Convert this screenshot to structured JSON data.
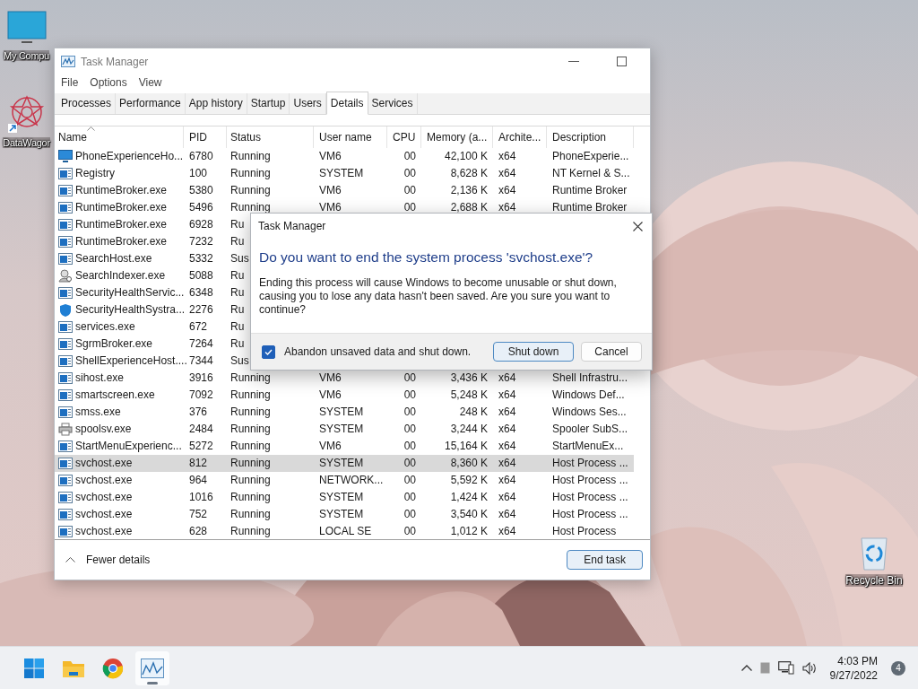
{
  "desktop_icons": [
    {
      "kind": "monitor",
      "label": "My Compu"
    },
    {
      "kind": "shortcut",
      "label": "DataWagor"
    },
    {
      "kind": "recycle",
      "label": "Recycle Bin"
    }
  ],
  "window": {
    "title": "Task Manager",
    "menu": [
      "File",
      "Options",
      "View"
    ],
    "tabs": [
      {
        "label": "Processes",
        "selected": false
      },
      {
        "label": "Performance",
        "selected": false
      },
      {
        "label": "App history",
        "selected": false
      },
      {
        "label": "Startup",
        "selected": false
      },
      {
        "label": "Users",
        "selected": false
      },
      {
        "label": "Details",
        "selected": true
      },
      {
        "label": "Services",
        "selected": false
      }
    ],
    "table": {
      "columns": [
        "Name",
        "PID",
        "Status",
        "User name",
        "CPU",
        "Memory (a...",
        "Archite...",
        "Description"
      ],
      "rows": [
        {
          "kind": "monitor",
          "name": "PhoneExperienceHo...",
          "pid": "6780",
          "status": "Running",
          "user": "VM6",
          "cpu": "00",
          "memory": "42,100 K",
          "arch": "x64",
          "description": "PhoneExperie...",
          "selected": false
        },
        {
          "kind": "app",
          "name": "Registry",
          "pid": "100",
          "status": "Running",
          "user": "SYSTEM",
          "cpu": "00",
          "memory": "8,628 K",
          "arch": "x64",
          "description": "NT Kernel & S...",
          "selected": false
        },
        {
          "kind": "app",
          "name": "RuntimeBroker.exe",
          "pid": "5380",
          "status": "Running",
          "user": "VM6",
          "cpu": "00",
          "memory": "2,136 K",
          "arch": "x64",
          "description": "Runtime Broker",
          "selected": false
        },
        {
          "kind": "app",
          "name": "RuntimeBroker.exe",
          "pid": "5496",
          "status": "Running",
          "user": "VM6",
          "cpu": "00",
          "memory": "2,688 K",
          "arch": "x64",
          "description": "Runtime Broker",
          "selected": false
        },
        {
          "kind": "app",
          "name": "RuntimeBroker.exe",
          "pid": "6928",
          "status": "Ru",
          "selected": false
        },
        {
          "kind": "app",
          "name": "RuntimeBroker.exe",
          "pid": "7232",
          "status": "Ru",
          "selected": false
        },
        {
          "kind": "app",
          "name": "SearchHost.exe",
          "pid": "5332",
          "status": "Sus",
          "selected": false
        },
        {
          "kind": "search",
          "name": "SearchIndexer.exe",
          "pid": "5088",
          "status": "Ru",
          "selected": false
        },
        {
          "kind": "app",
          "name": "SecurityHealthServic...",
          "pid": "6348",
          "status": "Ru",
          "selected": false
        },
        {
          "kind": "shield",
          "name": "SecurityHealthSystra...",
          "pid": "2276",
          "status": "Ru",
          "selected": false
        },
        {
          "kind": "app",
          "name": "services.exe",
          "pid": "672",
          "status": "Ru",
          "selected": false
        },
        {
          "kind": "app",
          "name": "SgrmBroker.exe",
          "pid": "7264",
          "status": "Ru",
          "selected": false
        },
        {
          "kind": "app",
          "name": "ShellExperienceHost....",
          "pid": "7344",
          "status": "Sus",
          "selected": false
        },
        {
          "kind": "app",
          "name": "sihost.exe",
          "pid": "3916",
          "status": "Running",
          "user": "VM6",
          "cpu": "00",
          "memory": "3,436 K",
          "arch": "x64",
          "description": "Shell Infrastru...",
          "selected": false
        },
        {
          "kind": "app",
          "name": "smartscreen.exe",
          "pid": "7092",
          "status": "Running",
          "user": "VM6",
          "cpu": "00",
          "memory": "5,248 K",
          "arch": "x64",
          "description": "Windows Def...",
          "selected": false
        },
        {
          "kind": "app",
          "name": "smss.exe",
          "pid": "376",
          "status": "Running",
          "user": "SYSTEM",
          "cpu": "00",
          "memory": "248 K",
          "arch": "x64",
          "description": "Windows Ses...",
          "selected": false
        },
        {
          "kind": "printer",
          "name": "spoolsv.exe",
          "pid": "2484",
          "status": "Running",
          "user": "SYSTEM",
          "cpu": "00",
          "memory": "3,244 K",
          "arch": "x64",
          "description": "Spooler SubS...",
          "selected": false
        },
        {
          "kind": "app",
          "name": "StartMenuExperienc...",
          "pid": "5272",
          "status": "Running",
          "user": "VM6",
          "cpu": "00",
          "memory": "15,164 K",
          "arch": "x64",
          "description": "StartMenuEx...",
          "selected": false
        },
        {
          "kind": "app",
          "name": "svchost.exe",
          "pid": "812",
          "status": "Running",
          "user": "SYSTEM",
          "cpu": "00",
          "memory": "8,360 K",
          "arch": "x64",
          "description": "Host Process ...",
          "selected": true
        },
        {
          "kind": "app",
          "name": "svchost.exe",
          "pid": "964",
          "status": "Running",
          "user": "NETWORK...",
          "cpu": "00",
          "memory": "5,592 K",
          "arch": "x64",
          "description": "Host Process ...",
          "selected": false
        },
        {
          "kind": "app",
          "name": "svchost.exe",
          "pid": "1016",
          "status": "Running",
          "user": "SYSTEM",
          "cpu": "00",
          "memory": "1,424 K",
          "arch": "x64",
          "description": "Host Process ...",
          "selected": false
        },
        {
          "kind": "app",
          "name": "svchost.exe",
          "pid": "752",
          "status": "Running",
          "user": "SYSTEM",
          "cpu": "00",
          "memory": "3,540 K",
          "arch": "x64",
          "description": "Host Process ...",
          "selected": false
        },
        {
          "kind": "app",
          "name": "svchost.exe",
          "pid": "628",
          "status": "Running",
          "user": "LOCAL SE",
          "cpu": "00",
          "memory": "1,012 K",
          "arch": "x64",
          "description": "Host Process",
          "selected": false
        }
      ]
    },
    "footer": {
      "toggle": "Fewer details",
      "button": "End task"
    }
  },
  "dialog": {
    "title": "Task Manager",
    "heading": "Do you want to end the system process 'svchost.exe'?",
    "message": "Ending this process will cause Windows to become unusable or shut down, causing you to lose any data hasn't been saved. Are you sure you want to continue?",
    "checkbox": {
      "label": "Abandon unsaved data and shut down.",
      "checked": true
    },
    "buttons": [
      {
        "label": "Shut down",
        "default": true
      },
      {
        "label": "Cancel",
        "default": false
      }
    ]
  },
  "taskbar": {
    "apps": [
      {
        "kind": "start",
        "active": false
      },
      {
        "kind": "folder",
        "active": false
      },
      {
        "kind": "browser",
        "active": false
      },
      {
        "kind": "taskmgr",
        "active": true
      }
    ],
    "time": "4:03 PM",
    "date": "9/27/2022",
    "badge": "4"
  }
}
